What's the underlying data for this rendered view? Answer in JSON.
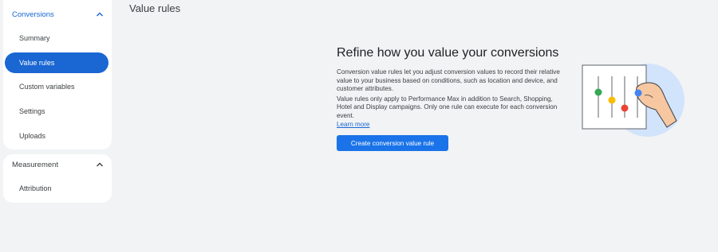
{
  "sidebar": {
    "sections": [
      {
        "title": "Conversions",
        "icon": "chevron-up-icon",
        "items": [
          {
            "label": "Summary",
            "active": false
          },
          {
            "label": "Value rules",
            "active": true
          },
          {
            "label": "Custom variables",
            "active": false
          },
          {
            "label": "Settings",
            "active": false
          },
          {
            "label": "Uploads",
            "active": false
          }
        ]
      },
      {
        "title": "Measurement",
        "icon": "chevron-up-icon",
        "items": [
          {
            "label": "Attribution",
            "active": false
          }
        ]
      }
    ]
  },
  "page": {
    "title": "Value rules"
  },
  "main": {
    "heading": "Refine how you value your conversions",
    "paragraph1": "Conversion value rules let you adjust conversion values to record their relative value to your business based on conditions, such as location and device, and customer attributes.",
    "paragraph2": "Value rules only apply to Performance Max in addition to Search, Shopping, Hotel and Display campaigns. Only one rule can execute for each conversion event.",
    "learn_more": "Learn more",
    "cta_label": "Create conversion value rule",
    "illustration": "sliders-hand-illustration"
  },
  "colors": {
    "accent": "#1a73e8",
    "active_nav": "#1a66d2",
    "background": "#f1f3f4",
    "slider_green": "#34a853",
    "slider_yellow": "#fbbc04",
    "slider_red": "#ea4335",
    "slider_blue": "#4285f4"
  }
}
